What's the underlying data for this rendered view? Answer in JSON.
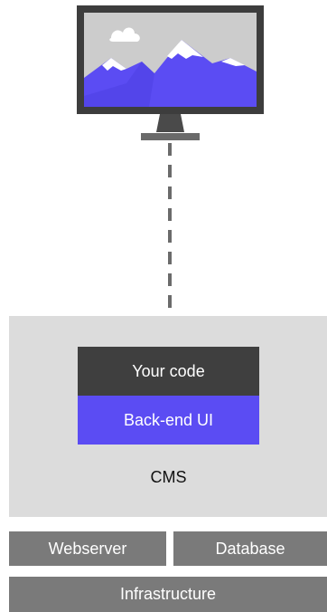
{
  "cms": {
    "label": "CMS",
    "stack": {
      "code_label": "Your code",
      "ui_label": "Back-end UI"
    }
  },
  "layers": {
    "webserver": "Webserver",
    "database": "Database",
    "infrastructure": "Infrastructure"
  },
  "colors": {
    "accent": "#5b4cf3",
    "dark_block": "#3f3f3f",
    "cms_background": "#dcdcdc",
    "layer_background": "#7a7a7a",
    "monitor_frame": "#3d3d3d"
  },
  "icons": {
    "monitor": "monitor-icon",
    "landscape": "mountain-landscape-icon"
  }
}
